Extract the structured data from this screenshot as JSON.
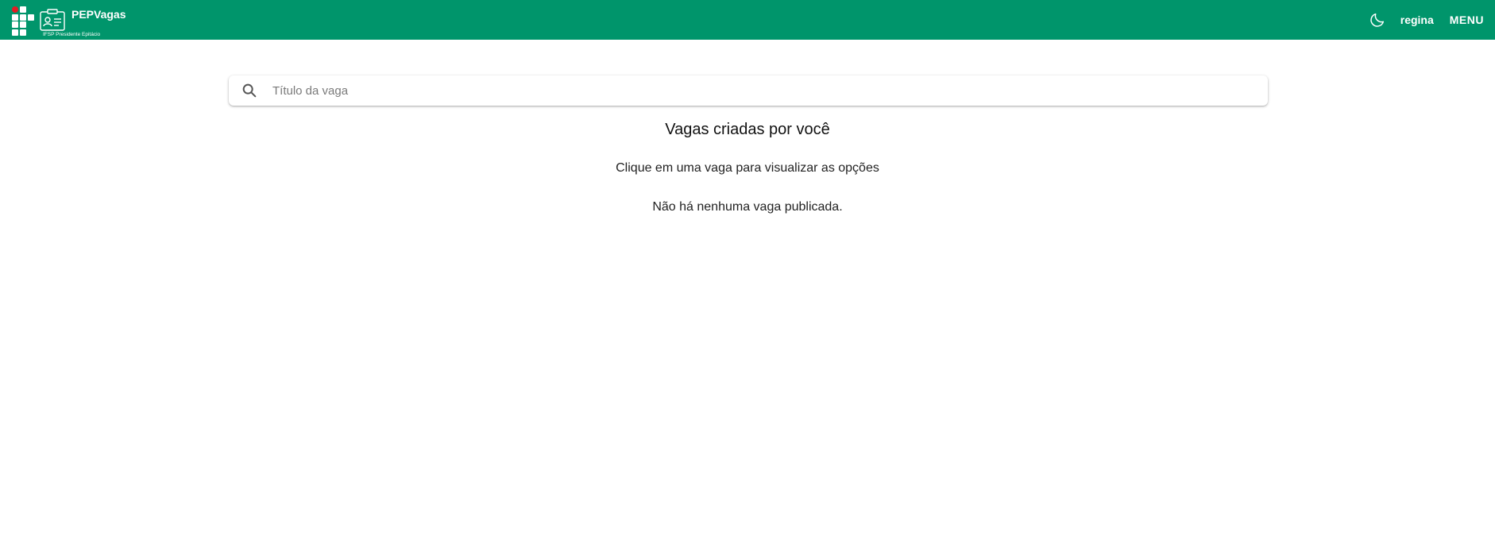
{
  "header": {
    "brand_title": "PEPVagas",
    "brand_subtitle": "IFSP Presidente Epitácio",
    "user_name": "regina",
    "menu_label": "MENU",
    "colors": {
      "header_bg": "#00956b",
      "logo_dot": "#e11d24"
    },
    "icons": {
      "logo": "if-grid-logo",
      "badge": "id-badge-icon",
      "theme_toggle": "moon-icon"
    }
  },
  "search": {
    "placeholder": "Título da vaga",
    "value": "",
    "icon": "search-icon"
  },
  "main": {
    "heading": "Vagas criadas por você",
    "hint": "Clique em uma vaga para visualizar as opções",
    "empty_message": "Não há nenhuma vaga publicada."
  }
}
